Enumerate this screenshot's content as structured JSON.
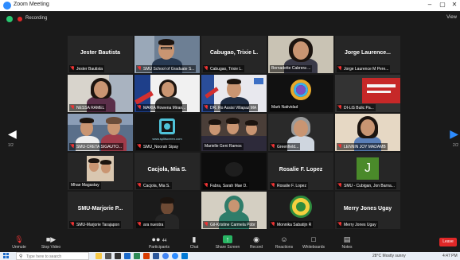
{
  "window": {
    "title": "Zoom Meeting",
    "minimize": "–",
    "maximize": "▢",
    "close": "✕"
  },
  "infobar": {
    "recording_label": "Recording",
    "view_label": "View"
  },
  "pagination": {
    "prev_page": "1/2",
    "next_page": "2/2"
  },
  "participants": [
    {
      "name": "Jester Bautista",
      "big_name": "Jester Bautista",
      "muted": true
    },
    {
      "name": "SMU School of Graduate S...",
      "video": "man-glasses",
      "muted": true
    },
    {
      "name": "Cabugao, Trixie L.",
      "big_name": "Cabugao, Trixie L.",
      "muted": true
    },
    {
      "name": "Bernadette Cabrera ...",
      "video": "woman-smile",
      "active": true,
      "muted": false
    },
    {
      "name": "Jorge Laurence M Pere...",
      "big_name": "Jorge Laurence...",
      "muted": true
    },
    {
      "name": "NESSA RAMEL",
      "video": "woman-office",
      "muted": true
    },
    {
      "name": "MARIA Rowena Miran...",
      "video": "woman-banner",
      "muted": true
    },
    {
      "name": "DR. Ro Assisi Villapaz MA",
      "video": "man-glasses-dark",
      "muted": true
    },
    {
      "name": "Mark Natividad",
      "video": "logo-ring",
      "muted": false
    },
    {
      "name": "DI-LiS Bulic Pa...",
      "video": "banner-red",
      "muted": true
    },
    {
      "name": "SMU-CRETA SIGAUTO...",
      "video": "two-women",
      "muted": true
    },
    {
      "name": "SMU_Noorah Sipay",
      "video": "logo-screen",
      "screen_text": "www.splitscreen.com",
      "muted": true
    },
    {
      "name": "Marielle Geni Ramos",
      "video": "three-people",
      "muted": false
    },
    {
      "name": "Greenfield...",
      "video": "woman-gray",
      "muted": true
    },
    {
      "name": "LENNIN JOY MADAMB",
      "video": "woman-young",
      "muted": true
    },
    {
      "name": "Mhae Magastay",
      "video": "couple",
      "muted": false
    },
    {
      "name": "Cacjola, Mia S.",
      "big_name": "Cacjola, Mia S.",
      "muted": true
    },
    {
      "name": "Fabra, Sarah Mae D.",
      "video": "dark-room",
      "muted": true
    },
    {
      "name": "Rosalie F. Lopez",
      "big_name": "Rosalie F. Lopez",
      "muted": true
    },
    {
      "name": "SMU - Cubigan, Jon Barna...",
      "avatar_letter": "J",
      "muted": true
    },
    {
      "name": "SMU-Marjorie Tarajapon",
      "big_name": "SMU-Marjorie P...",
      "muted": true
    },
    {
      "name": "ara nuestra",
      "video": "dark-person",
      "muted": true
    },
    {
      "name": "Gil-Kristine Carmela Pobr",
      "video": "woman-hijab",
      "muted": true
    },
    {
      "name": "Monnika Sabatijn R",
      "video": "logo-seal",
      "muted": true
    },
    {
      "name": "Merry Jones Ugay",
      "big_name": "Merry Jones Ugay",
      "muted": true
    }
  ],
  "toolbar": {
    "unmute": "Unmute",
    "stop_video": "Stop Video",
    "participants": "Participants",
    "participants_count": "44",
    "chat": "Chat",
    "share_screen": "Share Screen",
    "record": "Record",
    "reactions": "Reactions",
    "whiteboards": "Whiteboards",
    "notes": "Notes",
    "end": "Leave"
  },
  "taskbar": {
    "search_placeholder": "Type here to search",
    "weather": "28°C  Mostly sunny",
    "time": "4:47 PM"
  },
  "colors": {
    "accent": "#2d8cff",
    "active_speaker": "#e7e73a",
    "share_green": "#28b463",
    "end_red": "#e02828"
  }
}
